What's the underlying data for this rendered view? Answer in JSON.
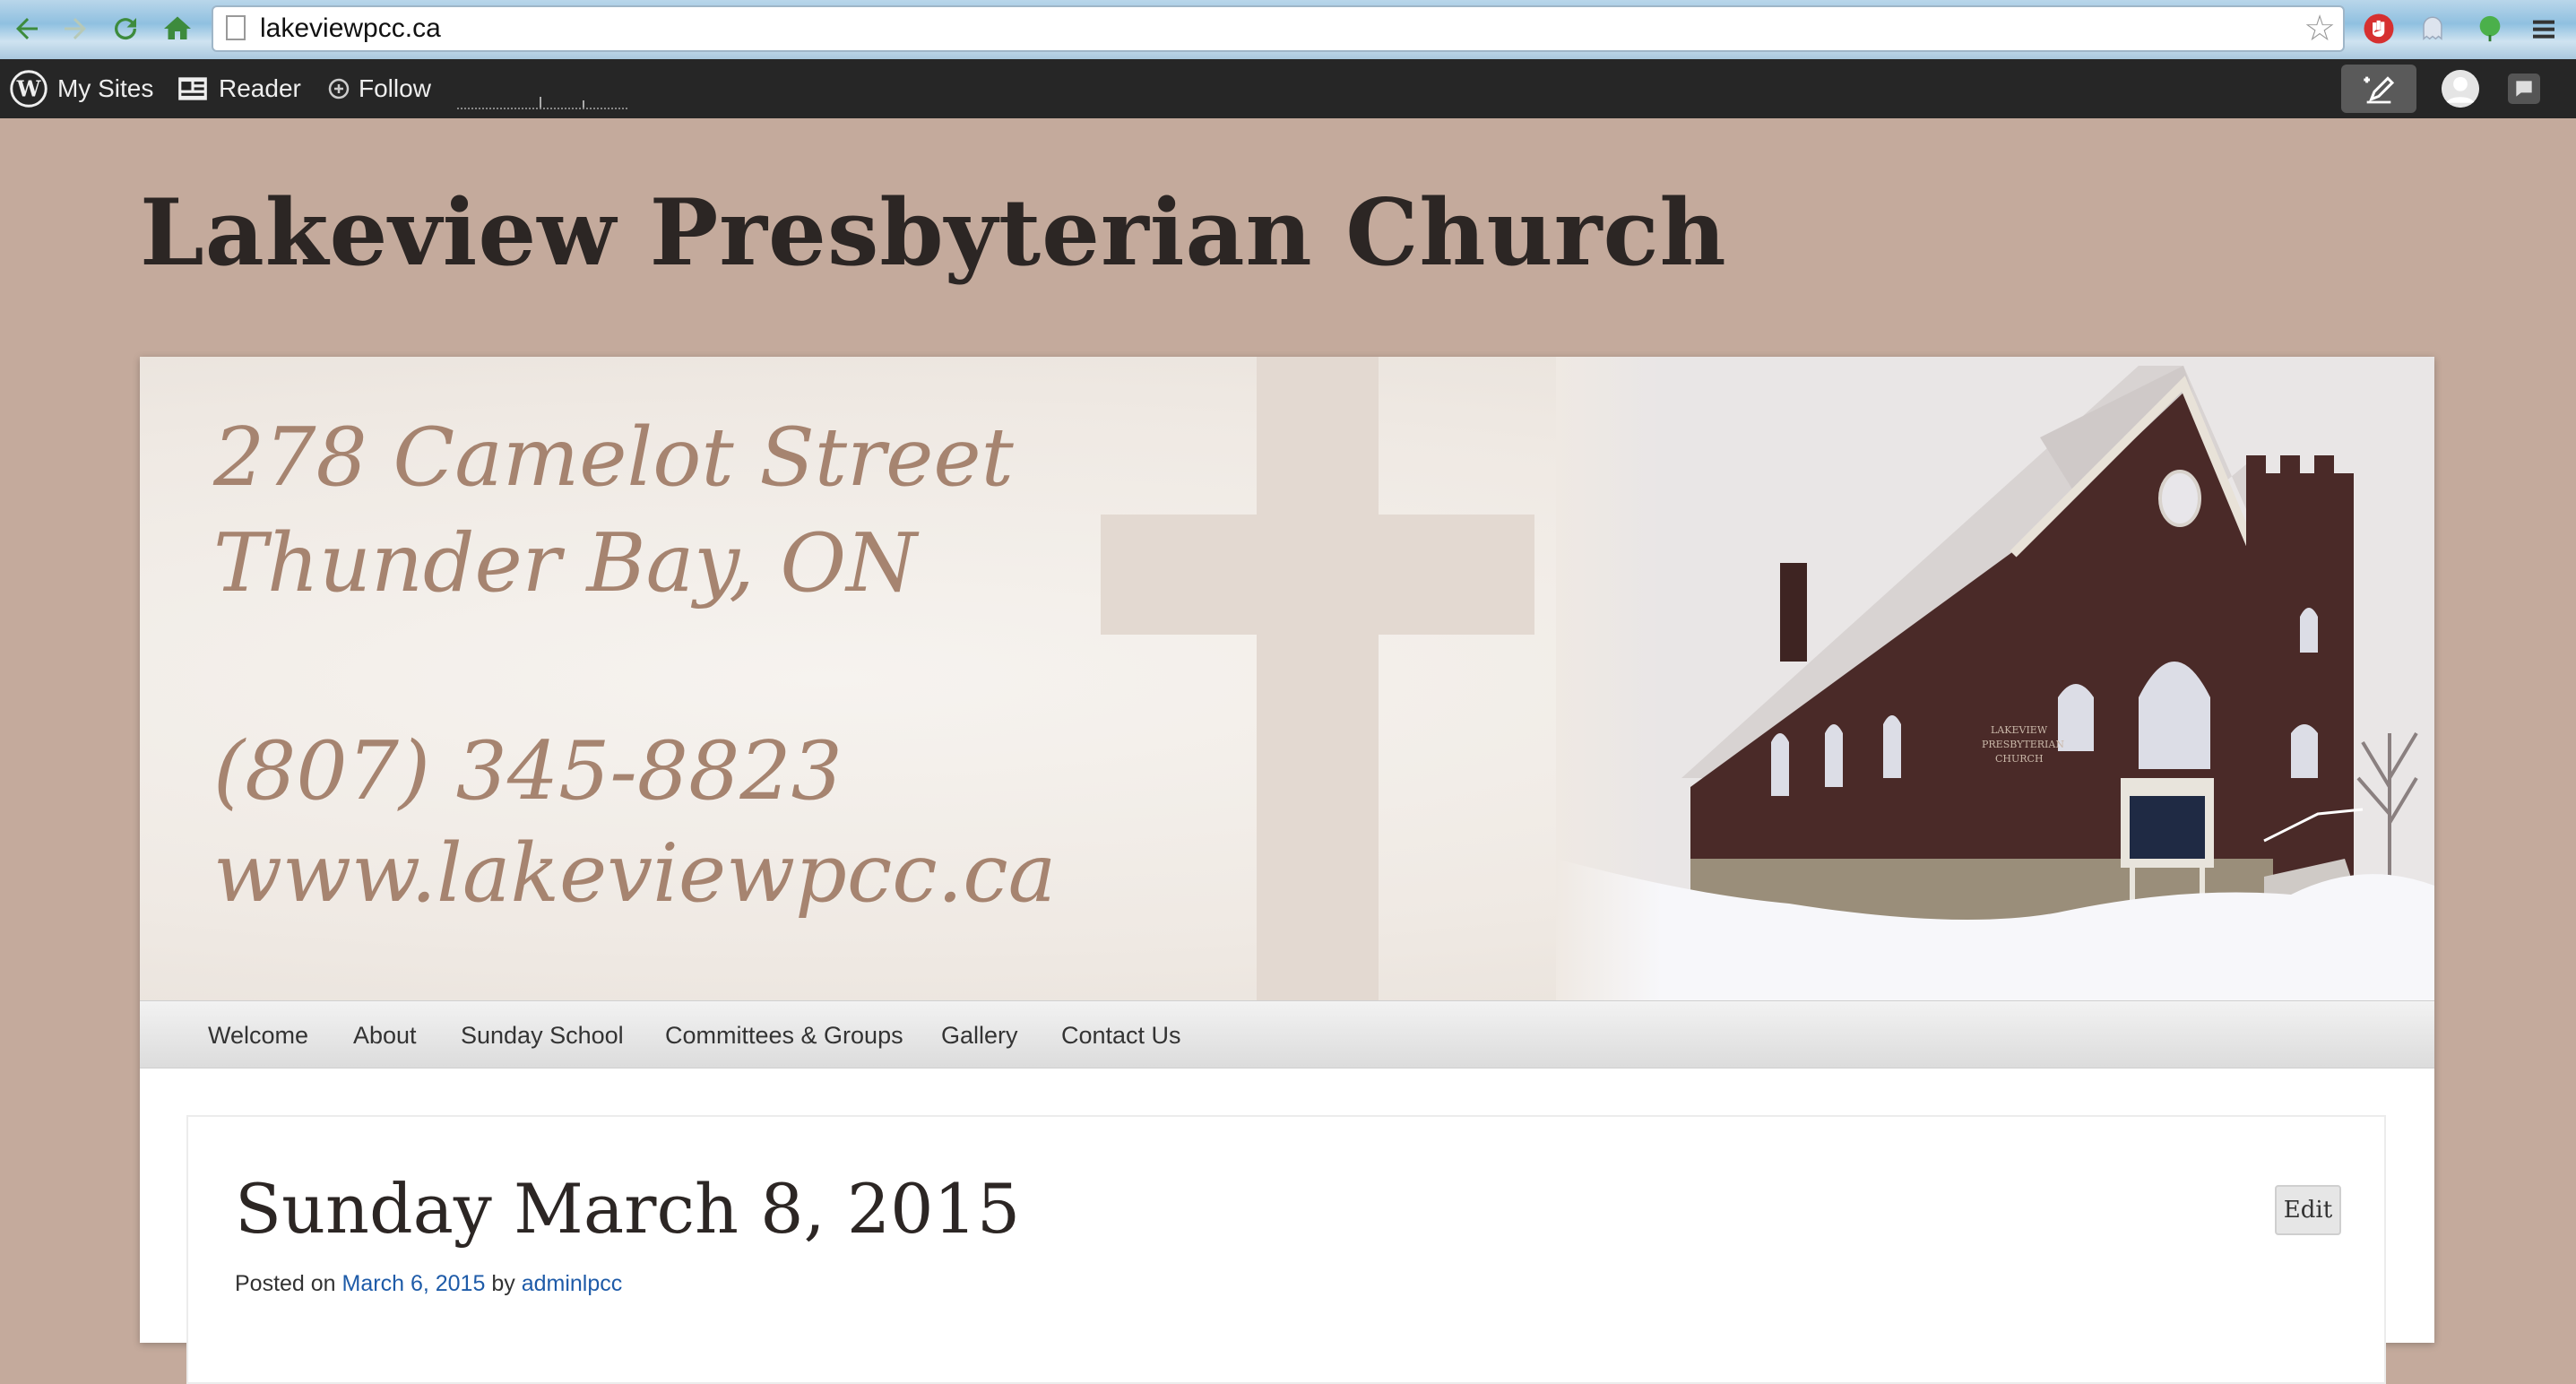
{
  "browser": {
    "url": "lakeviewpcc.ca"
  },
  "wp_bar": {
    "my_sites": "My Sites",
    "reader": "Reader",
    "follow": "Follow"
  },
  "site": {
    "title": "Lakeview Presbyterian Church"
  },
  "header_image": {
    "line1": "278 Camelot Street",
    "line2": "Thunder Bay, ON",
    "line3": "(807) 345-8823",
    "line4": "www.lakeviewpcc.ca"
  },
  "menu": {
    "items": [
      "Welcome",
      "About",
      "Sunday School",
      "Committees & Groups",
      "Gallery",
      "Contact Us"
    ]
  },
  "post": {
    "title": "Sunday March 8, 2015",
    "posted_on": "Posted on",
    "date": "March 6, 2015",
    "by": "by",
    "author": "adminlpcc",
    "edit_label": "Edit"
  },
  "icons": {
    "back": "back-arrow-icon",
    "forward": "forward-arrow-icon",
    "reload": "reload-icon",
    "home": "home-icon",
    "star": "bookmark-star-icon",
    "wordpress": "wordpress-logo-icon",
    "reader": "reader-icon",
    "follow": "follow-plus-icon",
    "new_post": "new-post-icon",
    "notifications": "notifications-icon"
  },
  "colors": {
    "page_bg": "#c4aa9c",
    "admin_bar": "#262626",
    "link": "#1e5ba8",
    "title": "#2c2624"
  }
}
